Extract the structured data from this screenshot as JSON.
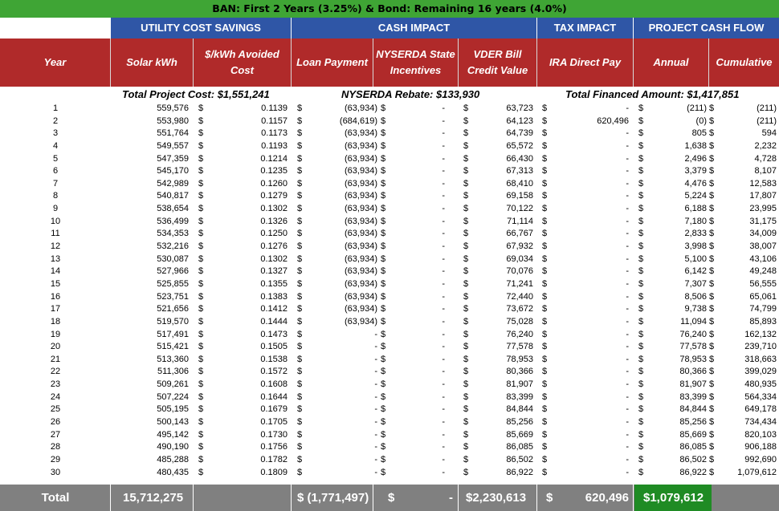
{
  "banner": "BAN: First 2 Years (3.25%) & Bond: Remaining 16 years (4.0%)",
  "groups": {
    "utility": "UTILITY COST SAVINGS",
    "cash": "CASH IMPACT",
    "tax": "TAX IMPACT",
    "flow": "PROJECT CASH FLOW"
  },
  "columns": {
    "year": "Year",
    "kwh": "Solar kWh",
    "rate": "$/kWh Avoided Cost",
    "loan": "Loan Payment",
    "nyserda": "NYSERDA State Incentives",
    "vder": "VDER Bill Credit Value",
    "ira": "IRA Direct Pay",
    "annual": "Annual",
    "cumulative": "Cumulative"
  },
  "subtitles": {
    "cost": "Total Project Cost: $1,551,241",
    "rebate": "NYSERDA Rebate: $133,930",
    "financed": "Total Financed Amount: $1,417,851"
  },
  "currency_symbol": "$",
  "rows": [
    [
      "1",
      "559,576",
      "0.1139",
      "(63,934)",
      "-",
      "63,723",
      "-",
      "(211)",
      "(211)"
    ],
    [
      "2",
      "553,980",
      "0.1157",
      "(684,619)",
      "-",
      "64,123",
      "620,496",
      "(0)",
      "(211)"
    ],
    [
      "3",
      "551,764",
      "0.1173",
      "(63,934)",
      "-",
      "64,739",
      "-",
      "805",
      "594"
    ],
    [
      "4",
      "549,557",
      "0.1193",
      "(63,934)",
      "-",
      "65,572",
      "-",
      "1,638",
      "2,232"
    ],
    [
      "5",
      "547,359",
      "0.1214",
      "(63,934)",
      "-",
      "66,430",
      "-",
      "2,496",
      "4,728"
    ],
    [
      "6",
      "545,170",
      "0.1235",
      "(63,934)",
      "-",
      "67,313",
      "-",
      "3,379",
      "8,107"
    ],
    [
      "7",
      "542,989",
      "0.1260",
      "(63,934)",
      "-",
      "68,410",
      "-",
      "4,476",
      "12,583"
    ],
    [
      "8",
      "540,817",
      "0.1279",
      "(63,934)",
      "-",
      "69,158",
      "-",
      "5,224",
      "17,807"
    ],
    [
      "9",
      "538,654",
      "0.1302",
      "(63,934)",
      "-",
      "70,122",
      "-",
      "6,188",
      "23,995"
    ],
    [
      "10",
      "536,499",
      "0.1326",
      "(63,934)",
      "-",
      "71,114",
      "-",
      "7,180",
      "31,175"
    ],
    [
      "11",
      "534,353",
      "0.1250",
      "(63,934)",
      "-",
      "66,767",
      "-",
      "2,833",
      "34,009"
    ],
    [
      "12",
      "532,216",
      "0.1276",
      "(63,934)",
      "-",
      "67,932",
      "-",
      "3,998",
      "38,007"
    ],
    [
      "13",
      "530,087",
      "0.1302",
      "(63,934)",
      "-",
      "69,034",
      "-",
      "5,100",
      "43,106"
    ],
    [
      "14",
      "527,966",
      "0.1327",
      "(63,934)",
      "-",
      "70,076",
      "-",
      "6,142",
      "49,248"
    ],
    [
      "15",
      "525,855",
      "0.1355",
      "(63,934)",
      "-",
      "71,241",
      "-",
      "7,307",
      "56,555"
    ],
    [
      "16",
      "523,751",
      "0.1383",
      "(63,934)",
      "-",
      "72,440",
      "-",
      "8,506",
      "65,061"
    ],
    [
      "17",
      "521,656",
      "0.1412",
      "(63,934)",
      "-",
      "73,672",
      "-",
      "9,738",
      "74,799"
    ],
    [
      "18",
      "519,570",
      "0.1444",
      "(63,934)",
      "-",
      "75,028",
      "-",
      "11,094",
      "85,893"
    ],
    [
      "19",
      "517,491",
      "0.1473",
      "-",
      "-",
      "76,240",
      "-",
      "76,240",
      "162,132"
    ],
    [
      "20",
      "515,421",
      "0.1505",
      "-",
      "-",
      "77,578",
      "-",
      "77,578",
      "239,710"
    ],
    [
      "21",
      "513,360",
      "0.1538",
      "-",
      "-",
      "78,953",
      "-",
      "78,953",
      "318,663"
    ],
    [
      "22",
      "511,306",
      "0.1572",
      "-",
      "-",
      "80,366",
      "-",
      "80,366",
      "399,029"
    ],
    [
      "23",
      "509,261",
      "0.1608",
      "-",
      "-",
      "81,907",
      "-",
      "81,907",
      "480,935"
    ],
    [
      "24",
      "507,224",
      "0.1644",
      "-",
      "-",
      "83,399",
      "-",
      "83,399",
      "564,334"
    ],
    [
      "25",
      "505,195",
      "0.1679",
      "-",
      "-",
      "84,844",
      "-",
      "84,844",
      "649,178"
    ],
    [
      "26",
      "500,143",
      "0.1705",
      "-",
      "-",
      "85,256",
      "-",
      "85,256",
      "734,434"
    ],
    [
      "27",
      "495,142",
      "0.1730",
      "-",
      "-",
      "85,669",
      "-",
      "85,669",
      "820,103"
    ],
    [
      "28",
      "490,190",
      "0.1756",
      "-",
      "-",
      "86,085",
      "-",
      "86,085",
      "906,188"
    ],
    [
      "29",
      "485,288",
      "0.1782",
      "-",
      "-",
      "86,502",
      "-",
      "86,502",
      "992,690"
    ],
    [
      "30",
      "480,435",
      "0.1809",
      "-",
      "-",
      "86,922",
      "-",
      "86,922",
      "1,079,612"
    ]
  ],
  "totals": {
    "label": "Total",
    "kwh": "15,712,275",
    "loan": "$ (1,771,497)",
    "nyserda_sym": "$",
    "nyserda": "-",
    "vder": "$2,230,613",
    "ira_sym": "$",
    "ira": "620,496",
    "annual": "$1,079,612"
  }
}
